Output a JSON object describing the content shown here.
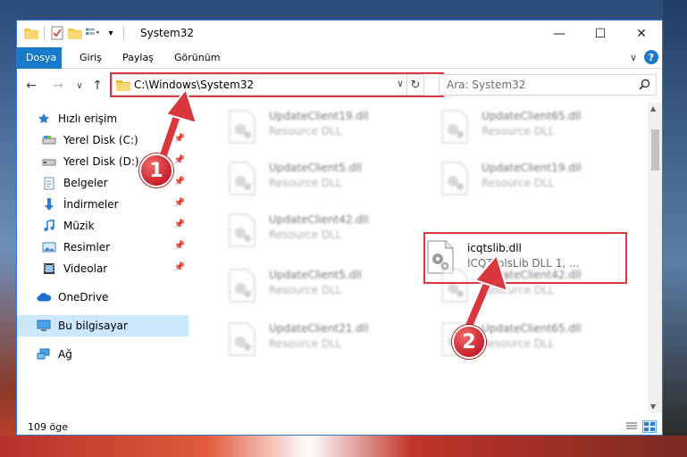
{
  "window": {
    "title": "System32",
    "controls": {
      "minimize": "—",
      "maximize": "☐",
      "close": "✕"
    }
  },
  "ribbon": {
    "tabs": [
      {
        "label": "Dosya",
        "active": true
      },
      {
        "label": "Giriş",
        "active": false
      },
      {
        "label": "Paylaş",
        "active": false
      },
      {
        "label": "Görünüm",
        "active": false
      }
    ],
    "expand_glyph": "∨",
    "help_glyph": "?"
  },
  "address": {
    "path": "C:\\Windows\\System32",
    "dropdown_glyph": "∨",
    "refresh_glyph": "↻"
  },
  "search": {
    "placeholder": "Ara: System32",
    "icon": "search-icon"
  },
  "nav": {
    "back": "←",
    "forward": "→",
    "recent": "∨",
    "up": "↑"
  },
  "sidebar": {
    "items": [
      {
        "label": "Hızlı erişim",
        "icon": "star-icon",
        "pinned": false
      },
      {
        "label": "Yerel Disk (C:)",
        "icon": "drive-icon",
        "pinned": true
      },
      {
        "label": "Yerel Disk (D:)",
        "icon": "drive-icon",
        "pinned": true
      },
      {
        "label": "Belgeler",
        "icon": "document-icon",
        "pinned": true
      },
      {
        "label": "İndirmeler",
        "icon": "download-icon",
        "pinned": true
      },
      {
        "label": "Müzik",
        "icon": "music-icon",
        "pinned": true
      },
      {
        "label": "Resimler",
        "icon": "pictures-icon",
        "pinned": true
      },
      {
        "label": "Videolar",
        "icon": "video-icon",
        "pinned": true
      },
      {
        "label": "OneDrive",
        "icon": "cloud-icon",
        "pinned": false
      },
      {
        "label": "Bu bilgisayar",
        "icon": "computer-icon",
        "pinned": false,
        "selected": true
      },
      {
        "label": "Ağ",
        "icon": "network-icon",
        "pinned": false
      }
    ]
  },
  "files": {
    "left": [
      {
        "name": "UpdateClient19.dll",
        "desc": "Resource DLL"
      },
      {
        "name": "UpdateClient5.dll",
        "desc": "Resource DLL"
      },
      {
        "name": "UpdateClient42.dll",
        "desc": "Resource DLL"
      },
      {
        "name": "UpdateClient5.dll",
        "desc": "Resource DLL"
      },
      {
        "name": "UpdateClient21.dll",
        "desc": "Resource DLL"
      }
    ],
    "right": [
      {
        "name": "UpdateClient65.dll",
        "desc": "Resource DLL"
      },
      {
        "name": "UpdateClient19.dll",
        "desc": "Resource DLL"
      },
      {
        "name": "icqtslib.dll",
        "desc": "ICQToolsLib DLL 1, ...",
        "highlighted": true
      },
      {
        "name": "UpdateClient42.dll",
        "desc": "Resource DLL"
      },
      {
        "name": "UpdateClient65.dll",
        "desc": "Resource DLL"
      }
    ]
  },
  "status": {
    "count": "109 öge"
  },
  "annotations": {
    "step1": "1",
    "step2": "2",
    "color": "#d9363e"
  }
}
